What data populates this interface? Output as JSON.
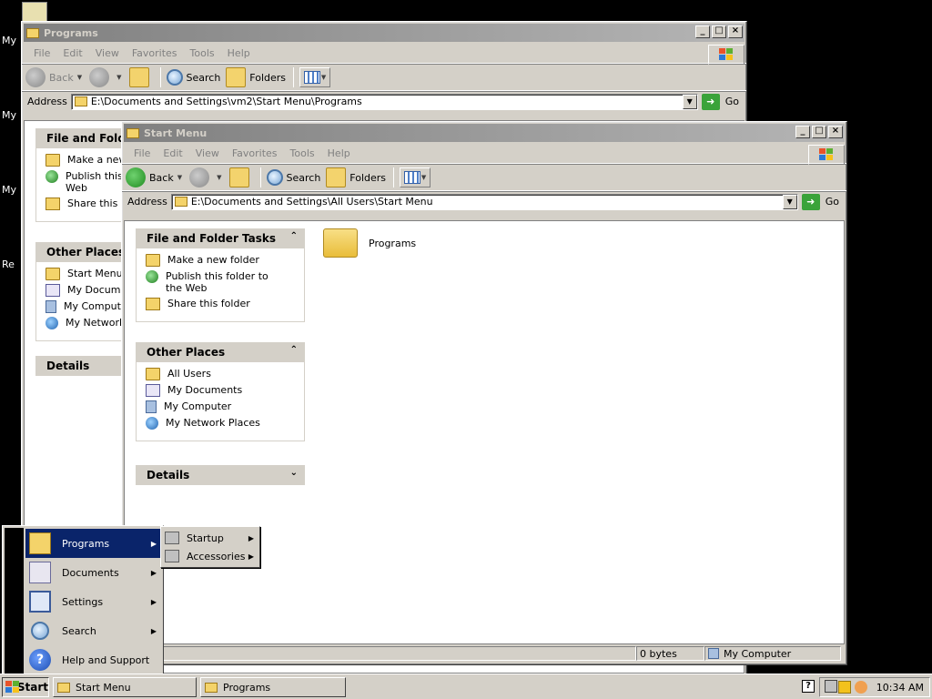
{
  "desktop": {
    "icon_labels": [
      "My",
      "My",
      "My",
      "Re"
    ]
  },
  "window_programs": {
    "title": "Programs",
    "menu": [
      "File",
      "Edit",
      "View",
      "Favorites",
      "Tools",
      "Help"
    ],
    "toolbar": {
      "back": "Back",
      "search": "Search",
      "folders": "Folders"
    },
    "address_label": "Address",
    "address": "E:\\Documents and Settings\\vm2\\Start Menu\\Programs",
    "go": "Go",
    "file_tasks_title": "File and Folde",
    "tasks": [
      "Make a new",
      "Publish this",
      "Web",
      "Share this fo"
    ],
    "other_places_title": "Other Places",
    "places": [
      "Start Menu",
      "My Docume",
      "My Compute",
      "My Network"
    ],
    "details_title": "Details"
  },
  "window_startmenu": {
    "title": "Start Menu",
    "menu": [
      "File",
      "Edit",
      "View",
      "Favorites",
      "Tools",
      "Help"
    ],
    "toolbar": {
      "back": "Back",
      "search": "Search",
      "folders": "Folders"
    },
    "address_label": "Address",
    "address": "E:\\Documents and Settings\\All Users\\Start Menu",
    "go": "Go",
    "file_tasks_title": "File and Folder Tasks",
    "tasks": [
      "Make a new folder",
      "Publish this folder to the Web",
      "Share this folder"
    ],
    "other_places_title": "Other Places",
    "places": [
      "All Users",
      "My Documents",
      "My Computer",
      "My Network Places"
    ],
    "details_title": "Details",
    "items": [
      {
        "label": "Programs",
        "icon": "folder-icon"
      }
    ],
    "status": {
      "size": "0 bytes",
      "location": "My Computer"
    }
  },
  "start_menu": {
    "items": [
      "Programs",
      "Documents",
      "Settings",
      "Search",
      "Help and Support"
    ],
    "programs_submenu": [
      "Startup",
      "Accessories"
    ]
  },
  "taskbar": {
    "start_label": "Start",
    "tasks": [
      "Start Menu",
      "Programs"
    ],
    "clock": "10:34 AM",
    "help_glyph": "?"
  }
}
